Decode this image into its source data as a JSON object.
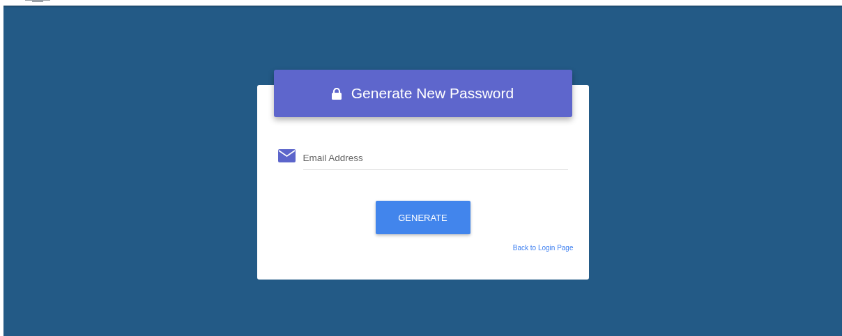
{
  "header": {
    "title": "Generate New Password"
  },
  "email_field": {
    "placeholder": "Email Address"
  },
  "generate_button": {
    "label": "GENERATE"
  },
  "back_link": {
    "label": "Back to Login Page"
  }
}
